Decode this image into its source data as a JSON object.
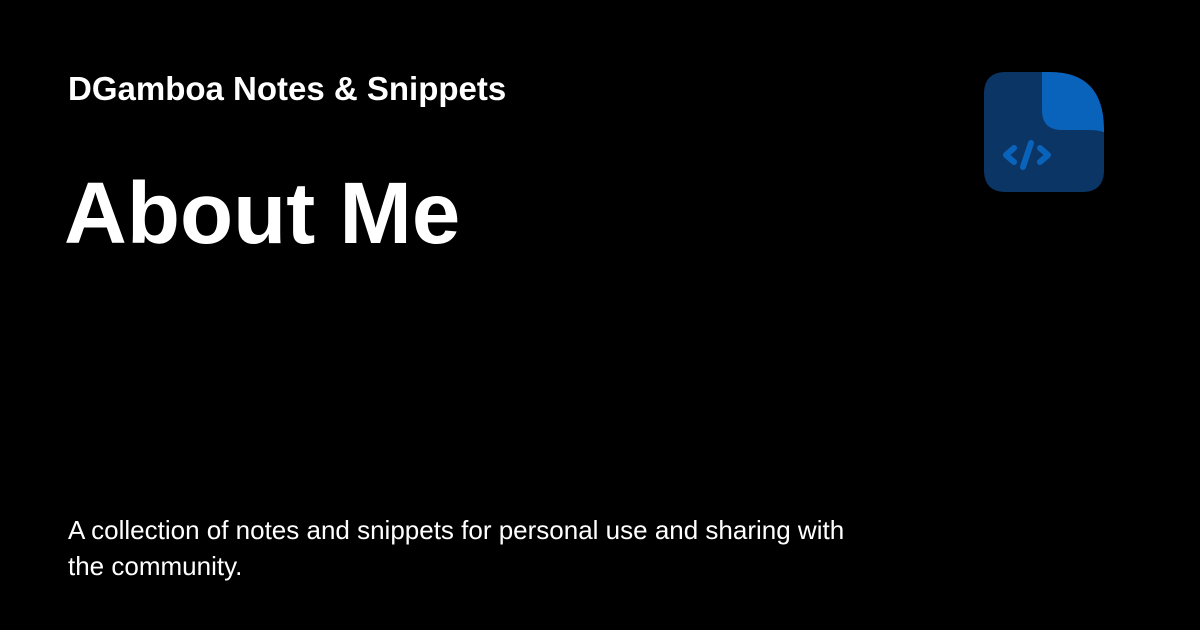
{
  "site": {
    "name": "DGamboa Notes & Snippets"
  },
  "page": {
    "title": "About Me",
    "description": "A collection of notes and snippets for personal use and sharing with the community."
  },
  "logo": {
    "icon": "code-file-icon",
    "colors": {
      "body": "#0b3564",
      "fold": "#0a63bb",
      "glyph": "#0a63bb"
    }
  },
  "theme": {
    "background": "#000000",
    "text": "#ffffff"
  }
}
